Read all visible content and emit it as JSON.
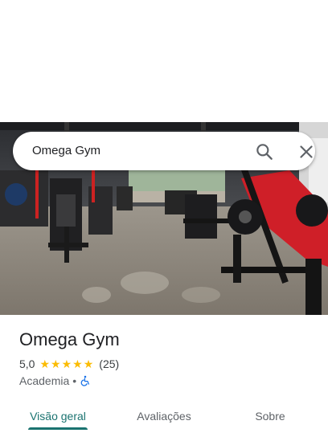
{
  "search": {
    "query": "Omega Gym"
  },
  "place": {
    "name": "Omega Gym",
    "rating": "5,0",
    "stars": 5,
    "review_count": "(25)",
    "category": "Academia",
    "separator": "•"
  },
  "tabs": [
    {
      "label": "Visão geral",
      "active": true
    },
    {
      "label": "Avaliações",
      "active": false
    },
    {
      "label": "Sobre",
      "active": false
    }
  ],
  "colors": {
    "accent": "#1a7370",
    "star": "#fbbc04",
    "access": "#1a73e8"
  },
  "icons": {
    "search": "search-icon",
    "close": "close-icon",
    "accessibility": "wheelchair-icon"
  }
}
